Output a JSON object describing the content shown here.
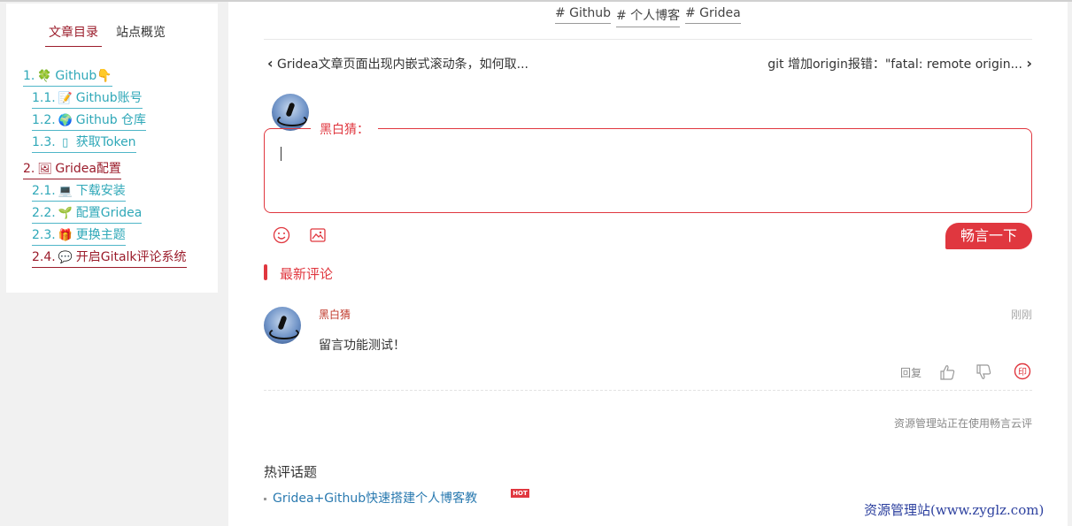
{
  "toc": {
    "tabs": [
      "文章目录",
      "站点概览"
    ],
    "active_tab": 0,
    "items": [
      {
        "num": "1.",
        "emoji": "🍀",
        "label": "Github👇",
        "level": 1,
        "color": "teal"
      },
      {
        "num": "1.1.",
        "emoji": "📝",
        "label": "Github账号",
        "level": 2,
        "color": "teal"
      },
      {
        "num": "1.2.",
        "emoji": "🌍",
        "label": "Github 仓库",
        "level": 2,
        "color": "teal"
      },
      {
        "num": "1.3.",
        "emoji": "▯",
        "label": "获取Token",
        "level": 2,
        "color": "teal"
      },
      {
        "num": "2.",
        "emoji": "🖼",
        "label": "Gridea配置",
        "level": 1,
        "color": "red"
      },
      {
        "num": "2.1.",
        "emoji": "💻",
        "label": "下载安装",
        "level": 2,
        "color": "teal"
      },
      {
        "num": "2.2.",
        "emoji": "🌱",
        "label": "配置Gridea",
        "level": 2,
        "color": "teal"
      },
      {
        "num": "2.3.",
        "emoji": "🎁",
        "label": "更换主题",
        "level": 2,
        "color": "teal"
      },
      {
        "num": "2.4.",
        "emoji": "💬",
        "label": "开启Gitalk评论系统",
        "level": 2,
        "color": "red"
      }
    ]
  },
  "tags": [
    "# Github",
    "# 个人博客",
    "# Gridea"
  ],
  "post_nav": {
    "prev": "Gridea文章页面出现内嵌式滚动条，如何取...",
    "next": "git 增加origin报错：\"fatal: remote origin..."
  },
  "comment_form": {
    "nickname_label": "黑白猜：",
    "submit_label": "畅言一下"
  },
  "comments": {
    "section_title": "最新评论",
    "items": [
      {
        "user": "黑白猜",
        "time": "刚刚",
        "text": "留言功能测试！",
        "reply_label": "回复"
      }
    ],
    "powered_by": "资源管理站正在使用畅言云评"
  },
  "hot_topics": {
    "title": "热评话题",
    "items": [
      {
        "label": "Gridea+Github快速搭建个人博客教",
        "badge": "HOT"
      }
    ]
  },
  "watermark": "资源管理站(www.zyglz.com)",
  "colors": {
    "accent_red": "#e0373f",
    "dark_red": "#9b1c2b",
    "teal": "#2fa8b8",
    "link_blue": "#2a7ab0"
  }
}
